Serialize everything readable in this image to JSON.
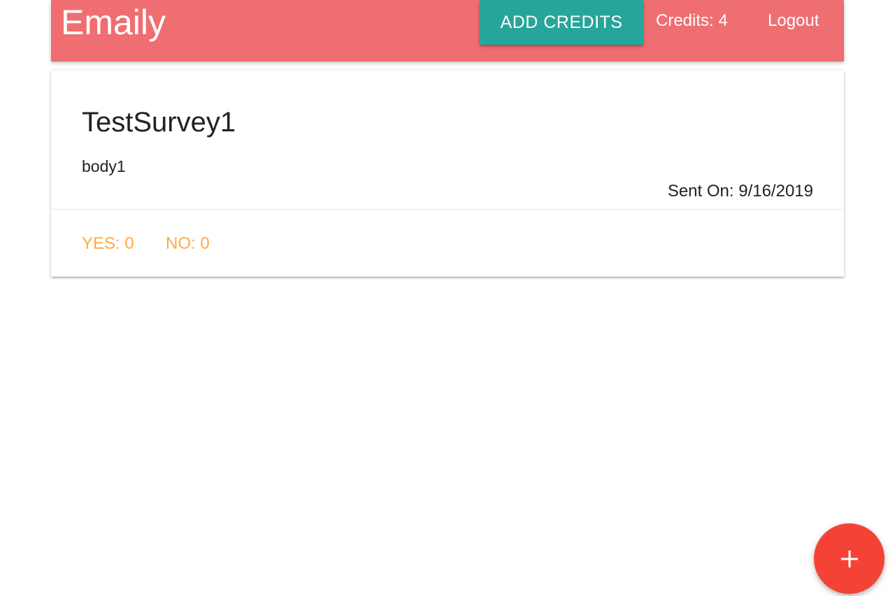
{
  "header": {
    "brand": "Emaily",
    "add_credits_label": "ADD CREDITS",
    "credits_text": "Credits: 4",
    "logout_label": "Logout"
  },
  "surveys": [
    {
      "title": "TestSurvey1",
      "body": "body1",
      "sent_on": "Sent On: 9/16/2019",
      "yes": "YES: 0",
      "no": "NO: 0"
    }
  ],
  "fab": {
    "icon": "add-icon"
  },
  "colors": {
    "navbar": "#ef6e72",
    "add_credits_button": "#26a69a",
    "vote_links": "#ffab40",
    "fab": "#f44336"
  }
}
